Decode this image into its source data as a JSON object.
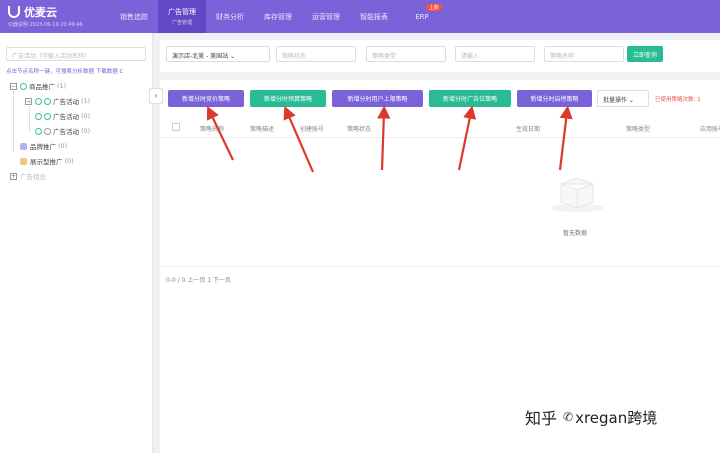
{
  "app": {
    "name": "优麦云",
    "subtitle": "仪器说明  2023-06-19 20:49:46"
  },
  "nav": [
    {
      "label": "销售追踪",
      "sub": ""
    },
    {
      "label": "广告管理",
      "sub": "广告管理"
    },
    {
      "label": "财务分析",
      "sub": ""
    },
    {
      "label": "库存管理",
      "sub": ""
    },
    {
      "label": "运营管理",
      "sub": ""
    },
    {
      "label": "智能报表",
      "sub": ""
    },
    {
      "label": "ERP",
      "sub": "",
      "badge": "上新"
    }
  ],
  "sidebar": {
    "search_placeholder": "广告活动（可输入活动名称）",
    "hint": "点击节点名称一键，可搜索分析数据   下载数据  C",
    "tree": [
      {
        "label": "商品推广",
        "count": "(1)"
      },
      {
        "label": "广告活动",
        "count": "(1)"
      },
      {
        "label": "广告活动",
        "count": "(0)"
      },
      {
        "label": "广告活动",
        "count": "(0)"
      },
      {
        "label": "品牌推广",
        "count": "(0)"
      },
      {
        "label": "展示型推广",
        "count": "(0)"
      },
      {
        "label": "广告组合",
        "count": ""
      }
    ]
  },
  "filters": {
    "shop": "演示店-北美 - 美国站",
    "status_placeholder": "策略状态",
    "type_placeholder": "策略类型",
    "keyword_placeholder": "请输入",
    "name_placeholder": "策略名称",
    "query_button": "立即查询"
  },
  "toolbar": {
    "buttons": [
      {
        "label": "新增分时竞价策略",
        "color": "#7a63d8"
      },
      {
        "label": "新增分时预算策略",
        "color": "#29bb93"
      },
      {
        "label": "新增分时用户上限策略",
        "color": "#7a63d8"
      },
      {
        "label": "新增分时广告位策略",
        "color": "#29bb93"
      },
      {
        "label": "新增分时启停策略",
        "color": "#7a63d8"
      }
    ],
    "batch": "批量操作 ⌄",
    "note": "已使用策略次数: 1"
  },
  "table": {
    "columns": [
      "策略名称",
      "策略描述",
      "创建账号",
      "策略状态",
      "生效日期",
      "策略类型",
      "应用账号"
    ]
  },
  "empty": "暂无数据",
  "pager": "0-0 / 0   上一页     1     下一页",
  "watermark": {
    "a": "知乎",
    "b": "xregan跨境"
  }
}
